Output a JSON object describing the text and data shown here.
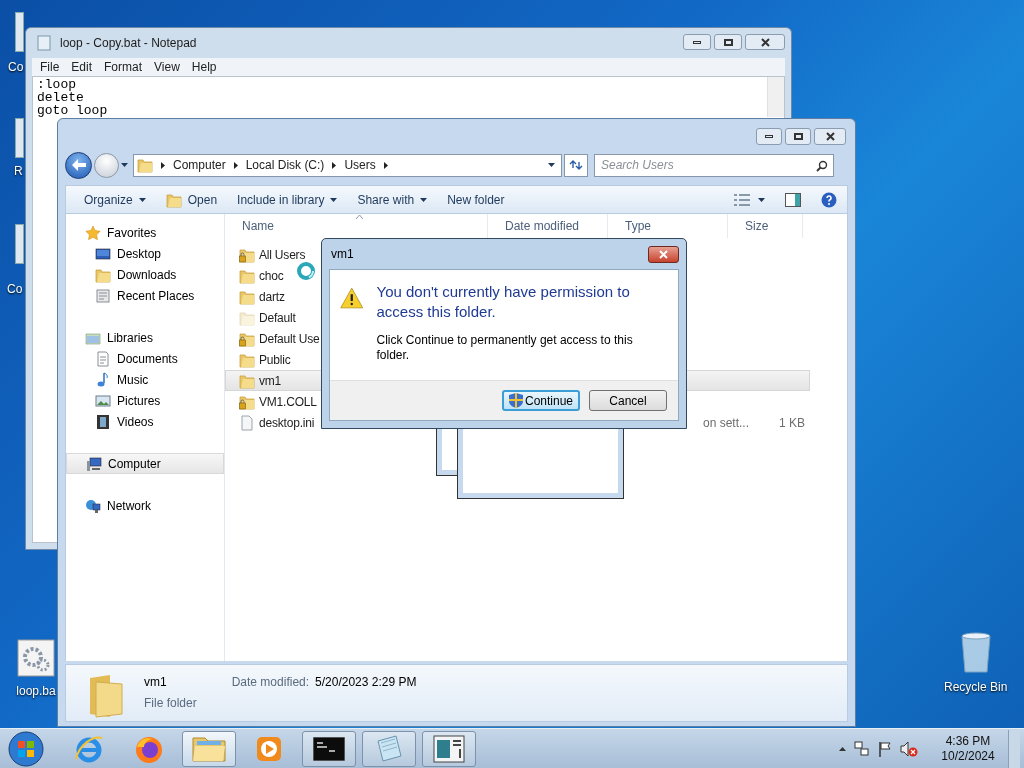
{
  "desktop": {
    "icons": [
      {
        "label": "Co"
      },
      {
        "label": "R"
      },
      {
        "label": "Co"
      },
      {
        "label": "loop.ba"
      },
      {
        "label": "Recycle Bin"
      }
    ]
  },
  "notepad": {
    "title": "loop - Copy.bat - Notepad",
    "menu": [
      "File",
      "Edit",
      "Format",
      "View",
      "Help"
    ],
    "lines": [
      ":loop",
      "delete",
      "goto loop"
    ]
  },
  "explorer": {
    "breadcrumb": [
      "Computer",
      "Local Disk (C:)",
      "Users"
    ],
    "search": {
      "placeholder": "Search Users"
    },
    "toolbar": [
      {
        "label": "Organize",
        "kind": "dropdown"
      },
      {
        "label": "Open",
        "kind": "icon"
      },
      {
        "label": "Include in library",
        "kind": "dropdown"
      },
      {
        "label": "Share with",
        "kind": "dropdown"
      },
      {
        "label": "New folder",
        "kind": "plain"
      }
    ],
    "sidebar": [
      {
        "label": "Favorites",
        "selected": false,
        "children": [
          {
            "label": "Desktop",
            "selected": false
          },
          {
            "label": "Downloads",
            "selected": false
          },
          {
            "label": "Recent Places",
            "selected": false
          }
        ]
      },
      {
        "label": "Libraries",
        "selected": false,
        "children": [
          {
            "label": "Documents",
            "selected": false
          },
          {
            "label": "Music",
            "selected": false
          },
          {
            "label": "Pictures",
            "selected": false
          },
          {
            "label": "Videos",
            "selected": false
          }
        ]
      },
      {
        "label": "Computer",
        "selected": true
      },
      {
        "label": "Network",
        "selected": false
      }
    ],
    "columns": [
      {
        "label": "Name",
        "sorted": true
      },
      {
        "label": "Date modified",
        "sorted": false
      },
      {
        "label": "Type",
        "sorted": false
      },
      {
        "label": "Size",
        "sorted": false
      }
    ],
    "rows": [
      {
        "name": "All Users",
        "kind": "locked",
        "selected": false
      },
      {
        "name": "choc",
        "kind": "folder",
        "selected": false
      },
      {
        "name": "dartz",
        "kind": "folder",
        "selected": false
      },
      {
        "name": "Default",
        "kind": "hidden",
        "selected": false
      },
      {
        "name": "Default Use",
        "kind": "locked",
        "selected": false
      },
      {
        "name": "Public",
        "kind": "folder",
        "selected": false
      },
      {
        "name": "vm1",
        "kind": "folder",
        "selected": true
      },
      {
        "name": "VM1.COLL",
        "kind": "locked",
        "selected": false
      },
      {
        "name": "desktop.ini",
        "kind": "file",
        "selected": false,
        "type": "on sett...",
        "size": "1 KB"
      }
    ],
    "details": {
      "name": "vm1",
      "type": "File folder",
      "date_label": "Date modified:",
      "date": "5/20/2023 2:29 PM"
    }
  },
  "dialog": {
    "title": "vm1",
    "heading": "You don't currently have permission to access this folder.",
    "message": "Click Continue to permanently get access to this folder.",
    "buttons": [
      {
        "label": "Continue",
        "kind": "shield",
        "focused": true
      },
      {
        "label": "Cancel",
        "kind": "plain",
        "focused": false
      }
    ]
  },
  "taskbar": {
    "items": [
      {
        "kind": "ie",
        "running": false,
        "selected": false
      },
      {
        "kind": "firefox",
        "running": false,
        "selected": false
      },
      {
        "kind": "explorer",
        "running": true,
        "selected": true
      },
      {
        "kind": "media",
        "running": false,
        "selected": false
      },
      {
        "kind": "cmd",
        "running": true,
        "selected": false
      },
      {
        "kind": "notepad",
        "running": true,
        "selected": false
      },
      {
        "kind": "app",
        "running": true,
        "selected": false
      }
    ],
    "time": "4:36 PM",
    "date": "10/2/2024"
  }
}
